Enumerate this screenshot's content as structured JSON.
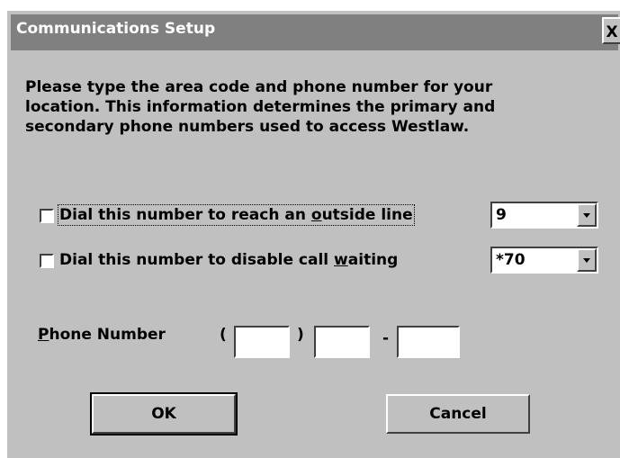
{
  "window": {
    "title": "Communications Setup",
    "close_glyph": "X"
  },
  "intro": {
    "line1": "Please type the area code and phone number for your",
    "line2": "location.  This information determines the primary and",
    "line3": "secondary phone numbers used to access Westlaw."
  },
  "outside_line": {
    "checked": false,
    "label_pre": "Dial this number to reach an ",
    "label_accel": "o",
    "label_post": "utside line",
    "value": "9"
  },
  "call_waiting": {
    "checked": false,
    "label_pre": "Dial this number to disable call ",
    "label_accel": "w",
    "label_post": "aiting",
    "value": "*70"
  },
  "phone": {
    "label_accel": "P",
    "label_post": "hone Number",
    "open_paren": "(",
    "close_paren": ")",
    "dash": "-",
    "area_code": "",
    "prefix": "",
    "line_number": ""
  },
  "buttons": {
    "ok": "OK",
    "cancel": "Cancel"
  }
}
